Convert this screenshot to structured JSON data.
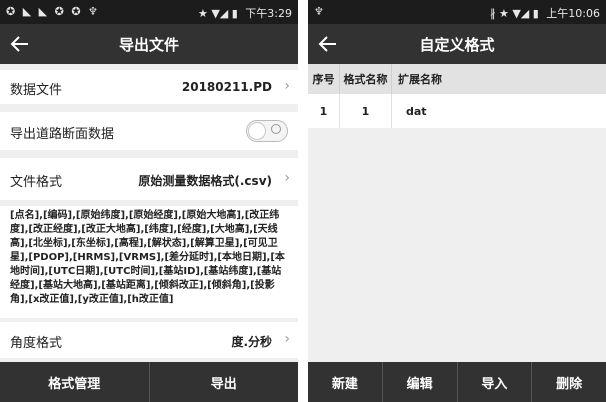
{
  "left_screen": {
    "status": {
      "icons": "✪ ◣ ◣ ✪ ✪ ♆",
      "right_icons": "★ ▼◢ ▮",
      "time": "下午3:29"
    },
    "title": "导出文件",
    "data_file": {
      "label": "数据文件",
      "value": "20180211.PD"
    },
    "road_section": {
      "label": "导出道路断面数据"
    },
    "file_format": {
      "label": "文件格式",
      "value": "原始测量数据格式(.csv)"
    },
    "fields_text": "[点名],[编码],[原始纬度],[原始经度],[原始大地高],[改正纬度],[改正经度],[改正大地高],[纬度],[经度],[大地高],[天线高],[北坐标],[东坐标],[高程],[解状态],[解算卫星],[可见卫星],[PDOP],[HRMS],[VRMS],[差分延时],[本地日期],[本地时间],[UTC日期],[UTC时间],[基站ID],[基站纬度],[基站经度],[基站大地高],[基站距离],[倾斜改正],[倾斜角],[投影角],[x改正值],[y改正值],[h改正值]",
    "angle_format": {
      "label": "角度格式",
      "value": "度.分秒"
    },
    "buttons": {
      "manage": "格式管理",
      "export": "导出"
    }
  },
  "right_screen": {
    "status": {
      "icons": "♆",
      "right_icons": "∦ ★ ▼◢ ▮",
      "time": "上午10:06"
    },
    "title": "自定义格式",
    "table": {
      "headers": [
        "序号",
        "格式名称",
        "扩展名称"
      ],
      "rows": [
        [
          "1",
          "1",
          "dat"
        ]
      ]
    },
    "buttons": {
      "new": "新建",
      "edit": "编辑",
      "import": "导入",
      "delete": "删除"
    }
  }
}
